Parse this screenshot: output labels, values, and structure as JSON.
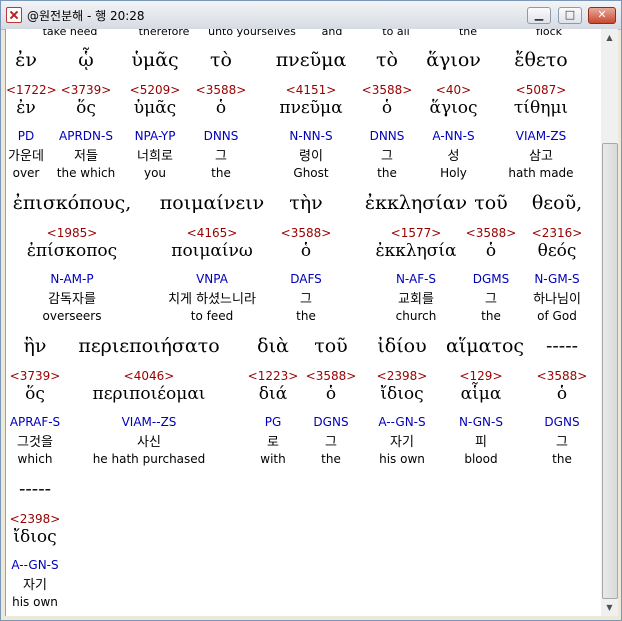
{
  "window": {
    "title": "@원전분해 - 행 20:28",
    "buttons": {
      "minimize": "▁",
      "maximize": "□",
      "close": "✕"
    }
  },
  "top_partial": [
    "take heed",
    "therefore",
    "unto yourselves",
    "and",
    "to all",
    "the",
    "flock"
  ],
  "rows": [
    {
      "words": [
        {
          "greek": "ἐν",
          "strong": "<1722>",
          "lemma": "ἐν",
          "parse": "PD",
          "korean": "가운데",
          "english": "over"
        },
        {
          "greek": "ᾧ",
          "strong": "<3739>",
          "lemma": "ὅς",
          "parse": "APRDN-S",
          "korean": "저들",
          "english": "the which"
        },
        {
          "greek": "ὑμᾶς",
          "strong": "<5209>",
          "lemma": "ὑμᾶς",
          "parse": "NPA-YP",
          "korean": "너희로",
          "english": "you"
        },
        {
          "greek": "τὸ",
          "strong": "<3588>",
          "lemma": "ὁ",
          "parse": "DNNS",
          "korean": "그",
          "english": "the"
        },
        {
          "greek": "πνεῦμα",
          "strong": "<4151>",
          "lemma": "πνεῦμα",
          "parse": "N-NN-S",
          "korean": "령이",
          "english": "Ghost"
        },
        {
          "greek": "τὸ",
          "strong": "<3588>",
          "lemma": "ὁ",
          "parse": "DNNS",
          "korean": "그",
          "english": "the"
        },
        {
          "greek": "ἅγιον",
          "strong": "<40>",
          "lemma": "ἅγιος",
          "parse": "A-NN-S",
          "korean": "성",
          "english": "Holy"
        },
        {
          "greek": "ἔθετο",
          "strong": "<5087>",
          "lemma": "τίθημι",
          "parse": "VIAM-ZS",
          "korean": "삼고",
          "english": "hath made"
        }
      ]
    },
    {
      "words": [
        {
          "greek": "ἐπισκόπους,",
          "strong": "<1985>",
          "lemma": "ἐπίσκοπος",
          "parse": "N-AM-P",
          "korean": "감독자를",
          "english": "overseers"
        },
        {
          "greek": "ποιμαίνειν",
          "strong": "<4165>",
          "lemma": "ποιμαίνω",
          "parse": "VNPA",
          "korean": "치게 하셨느니라",
          "english": "to feed"
        },
        {
          "greek": "τὴν",
          "strong": "<3588>",
          "lemma": "ὁ",
          "parse": "DAFS",
          "korean": "그",
          "english": "the"
        },
        {
          "greek": "ἐκκλησίαν",
          "strong": "<1577>",
          "lemma": "ἐκκλησία",
          "parse": "N-AF-S",
          "korean": "교회를",
          "english": "church"
        },
        {
          "greek": "τοῦ",
          "strong": "<3588>",
          "lemma": "ὁ",
          "parse": "DGMS",
          "korean": "그",
          "english": "the"
        },
        {
          "greek": "θεοῦ,",
          "strong": "<2316>",
          "lemma": "θεός",
          "parse": "N-GM-S",
          "korean": "하나님이",
          "english": "of God"
        }
      ]
    },
    {
      "words": [
        {
          "greek": "ἣν",
          "strong": "<3739>",
          "lemma": "ὅς",
          "parse": "APRAF-S",
          "korean": "그것을",
          "english": "which"
        },
        {
          "greek": "περιεποιήσατο",
          "strong": "<4046>",
          "lemma": "περιποιέομαι",
          "parse": "VIAM--ZS",
          "korean": "사신",
          "english": "he hath purchased"
        },
        {
          "greek": "διὰ",
          "strong": "<1223>",
          "lemma": "διά",
          "parse": "PG",
          "korean": "로",
          "english": "with"
        },
        {
          "greek": "τοῦ",
          "strong": "<3588>",
          "lemma": "ὁ",
          "parse": "DGNS",
          "korean": "그",
          "english": "the"
        },
        {
          "greek": "ἰδίου",
          "strong": "<2398>",
          "lemma": "ἴδιος",
          "parse": "A--GN-S",
          "korean": "자기",
          "english": "his own"
        },
        {
          "greek": "αἵματος",
          "strong": "<129>",
          "lemma": "αἷμα",
          "parse": "N-GN-S",
          "korean": "피",
          "english": "blood"
        },
        {
          "greek": "-----",
          "strong": "<3588>",
          "lemma": "ὁ",
          "parse": "DGNS",
          "korean": "그",
          "english": "the"
        }
      ]
    },
    {
      "words": [
        {
          "greek": "-----",
          "strong": "<2398>",
          "lemma": "ἴδιος",
          "parse": "A--GN-S",
          "korean": "자기",
          "english": "his own"
        }
      ]
    }
  ]
}
